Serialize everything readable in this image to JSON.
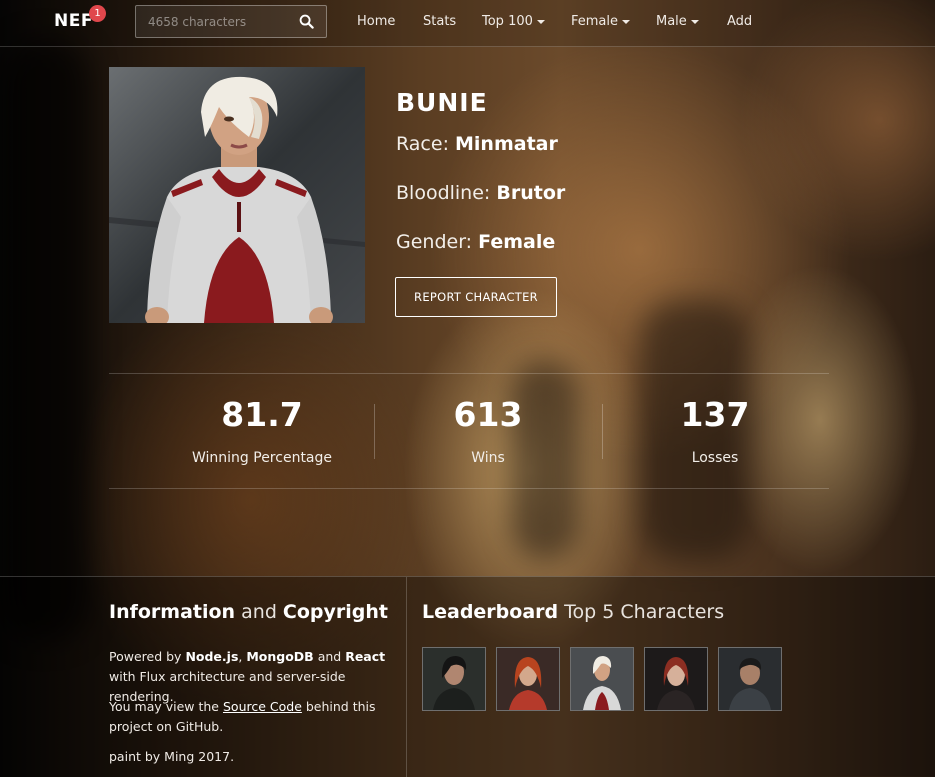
{
  "navbar": {
    "brand": "NEF",
    "badge": "1",
    "search_placeholder": "4658 characters",
    "links": {
      "home": "Home",
      "stats": "Stats",
      "top100": "Top 100",
      "female": "Female",
      "male": "Male",
      "add": "Add"
    }
  },
  "character": {
    "name": "BUNIE",
    "race_label": "Race: ",
    "race": "Minmatar",
    "bloodline_label": "Bloodline: ",
    "bloodline": "Brutor",
    "gender_label": "Gender: ",
    "gender": "Female",
    "report_button": "REPORT CHARACTER"
  },
  "stats": {
    "winning_percentage": {
      "value": "81.7",
      "label": "Winning Percentage"
    },
    "wins": {
      "value": "613",
      "label": "Wins"
    },
    "losses": {
      "value": "137",
      "label": "Losses"
    }
  },
  "footer": {
    "info": {
      "heading_a": "Information",
      "heading_and": " and ",
      "heading_b": "Copyright",
      "p1_a": "Powered by ",
      "p1_nodejs": "Node.js",
      "p1_comma": ", ",
      "p1_mongodb": "MongoDB",
      "p1_and": " and ",
      "p1_react": "React",
      "p1_rest": " with Flux architecture and server-side rendering.",
      "p2_a": "You may view the ",
      "p2_link": "Source Code",
      "p2_rest": " behind this project on GitHub.",
      "p3": "paint by Ming 2017."
    },
    "leaderboard": {
      "heading_a": "Leaderboard",
      "heading_b": " Top 5 Characters"
    }
  },
  "colors": {
    "badge": "#e0474c",
    "outfit_red": "#8a1a1e",
    "outfit_white": "#dcdcdc"
  }
}
